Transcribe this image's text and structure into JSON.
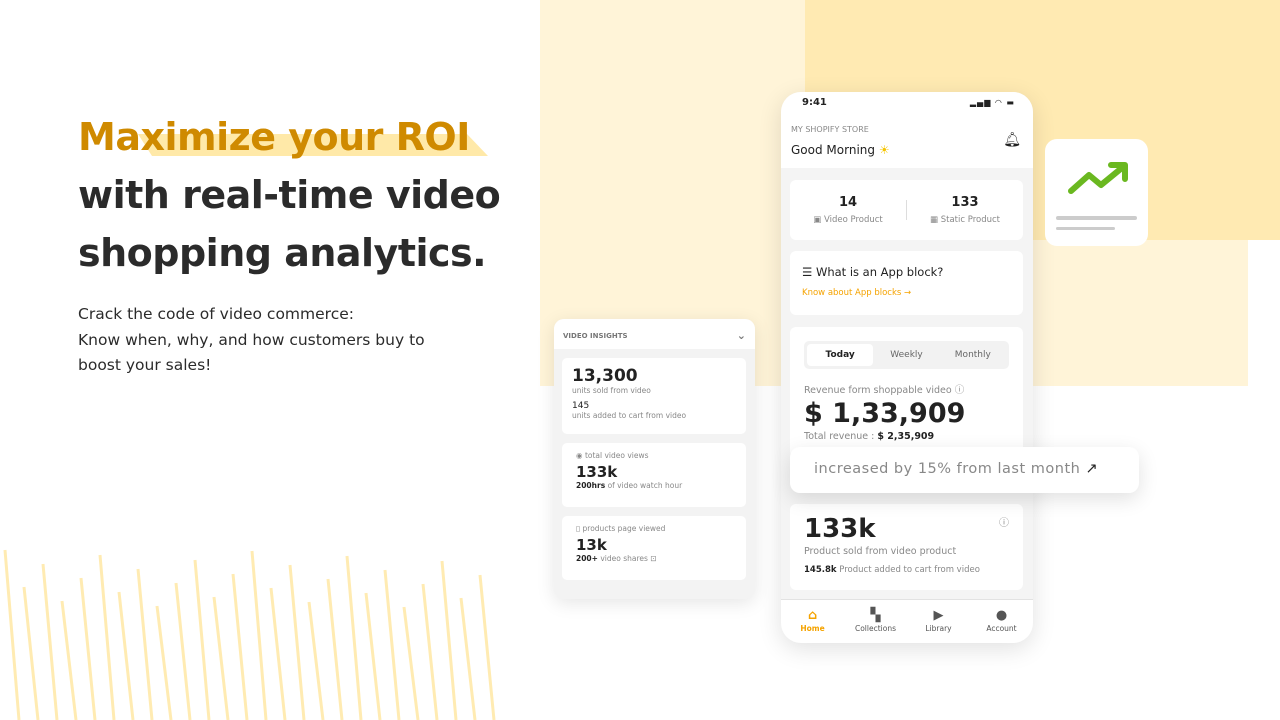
{
  "hero": {
    "title_accent": "Maximize your ROI",
    "title_line2": "with real-time video",
    "title_line3": "shopping analytics.",
    "sub_line1": "Crack the code of video commerce:",
    "sub_line2": "Know when, why, and how customers buy to",
    "sub_line3": "boost your sales!"
  },
  "colors": {
    "accent": "#cf8a00",
    "highlight": "#ffe9a8",
    "app_accent": "#f5a300",
    "trend_green": "#6ab820"
  },
  "phone": {
    "time": "9:41",
    "store": "MY SHOPIFY STORE",
    "greeting": "Good Morning",
    "stats": [
      {
        "value": "14",
        "label": "Video Product",
        "icon": "video-icon"
      },
      {
        "value": "133",
        "label": "Static Product",
        "icon": "image-icon"
      }
    ],
    "app_block": {
      "title": "What is an App block?",
      "link": "Know about App blocks"
    },
    "tabs": [
      "Today",
      "Weekly",
      "Monthly"
    ],
    "active_tab": "Today",
    "revenue": {
      "label": "Revenue form shoppable video",
      "value": "$ 1,33,909",
      "total_label": "Total revenue :",
      "total_value": "$ 2,35,909"
    },
    "products": {
      "value": "133k",
      "label": "Product sold from video product",
      "cart_value": "145.8k",
      "cart_label": "Product added to cart from video"
    },
    "nav": [
      {
        "label": "Home",
        "icon": "home-icon"
      },
      {
        "label": "Collections",
        "icon": "grid-icon"
      },
      {
        "label": "Library",
        "icon": "library-icon"
      },
      {
        "label": "Account",
        "icon": "user-icon"
      }
    ]
  },
  "insights": {
    "title": "VIDEO INSIGHTS",
    "units": "13,300",
    "units_label": "units sold from video",
    "cart": "145",
    "cart_label": "units added to cart from video",
    "views_label": "total video views",
    "views": "133k",
    "watch_value": "200hrs",
    "watch_label": "of video watch hour",
    "pages_label": "products page viewed",
    "pages": "13k",
    "shares_value": "200+",
    "shares_label": "video shares"
  },
  "toast": {
    "text": "increased by 15% from last month"
  }
}
